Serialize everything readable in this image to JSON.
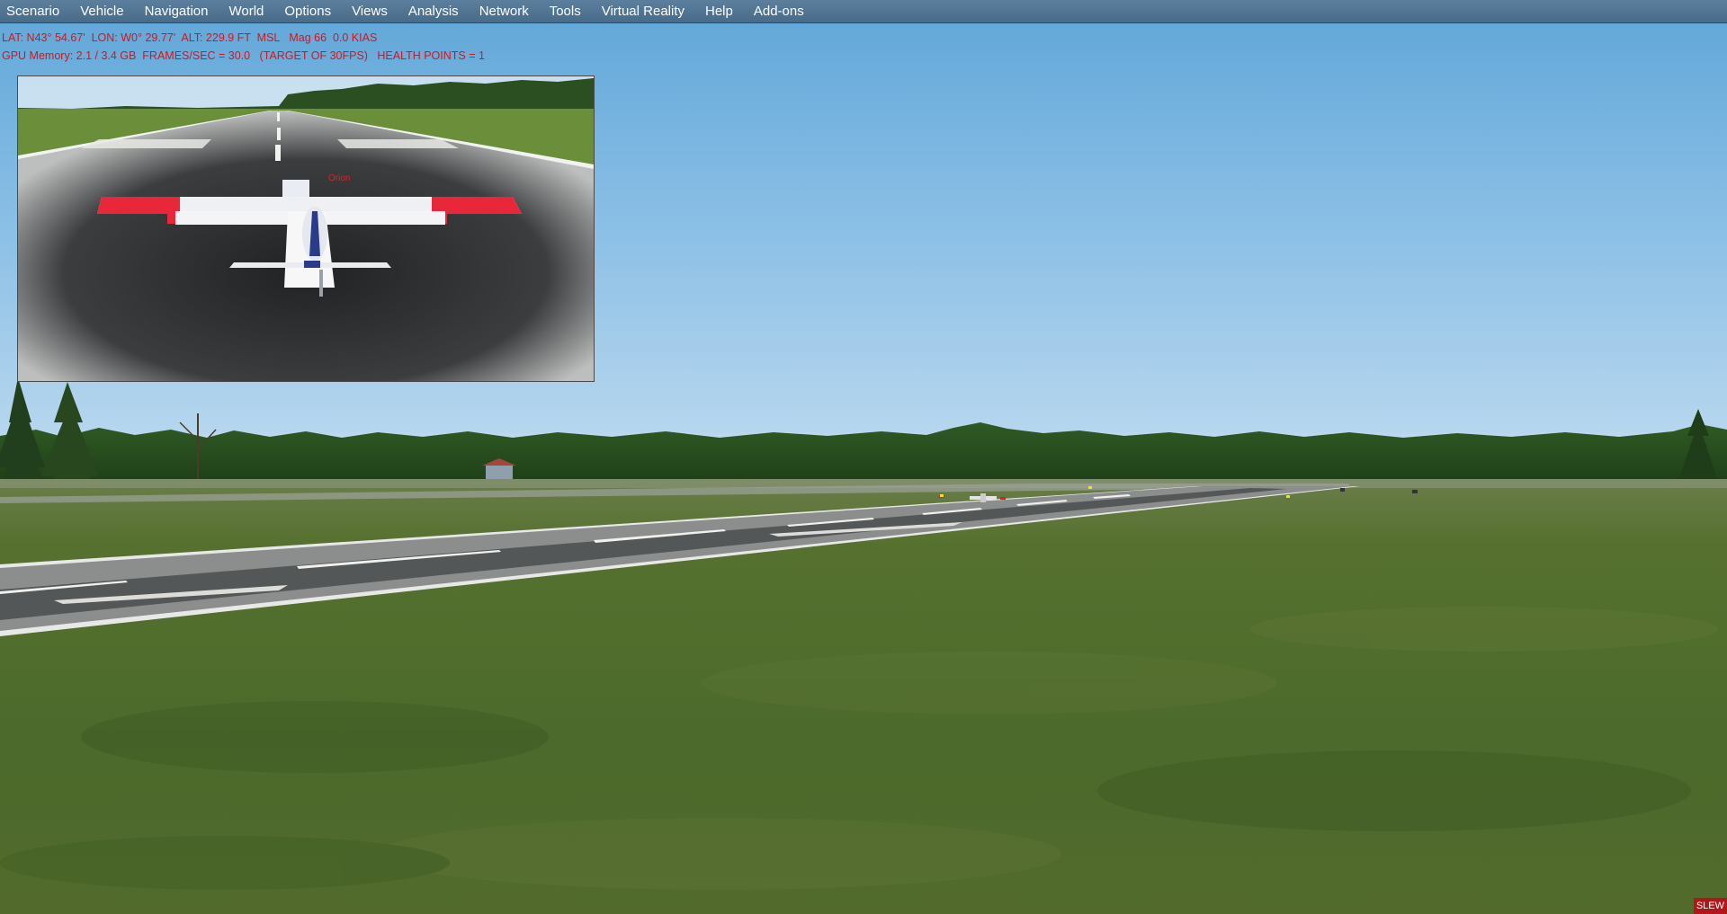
{
  "menu": {
    "items": [
      {
        "label": "Scenario"
      },
      {
        "label": "Vehicle"
      },
      {
        "label": "Navigation"
      },
      {
        "label": "World"
      },
      {
        "label": "Options"
      },
      {
        "label": "Views"
      },
      {
        "label": "Analysis"
      },
      {
        "label": "Network"
      },
      {
        "label": "Tools"
      },
      {
        "label": "Virtual Reality"
      },
      {
        "label": "Help"
      },
      {
        "label": "Add-ons"
      }
    ]
  },
  "hud": {
    "line1": "LAT: N43° 54.67'  LON: W0° 29.77'  ALT: 229.9 FT  MSL   Mag 66  0.0 KIAS",
    "line2": "GPU Memory: 2.1 / 3.4 GB  FRAMES/SEC = 30.0   (TARGET OF 30FPS)   HEALTH POINTS = 1"
  },
  "inset": {
    "aircraft_label": "Orion"
  },
  "status": {
    "slew": "SLEW"
  },
  "colors": {
    "menubar": "#4f7291",
    "hud_text": "#d4161b",
    "sky_top": "#5fa6d8",
    "grass": "#4c6a2a",
    "wing_tip": "#e8283a"
  }
}
